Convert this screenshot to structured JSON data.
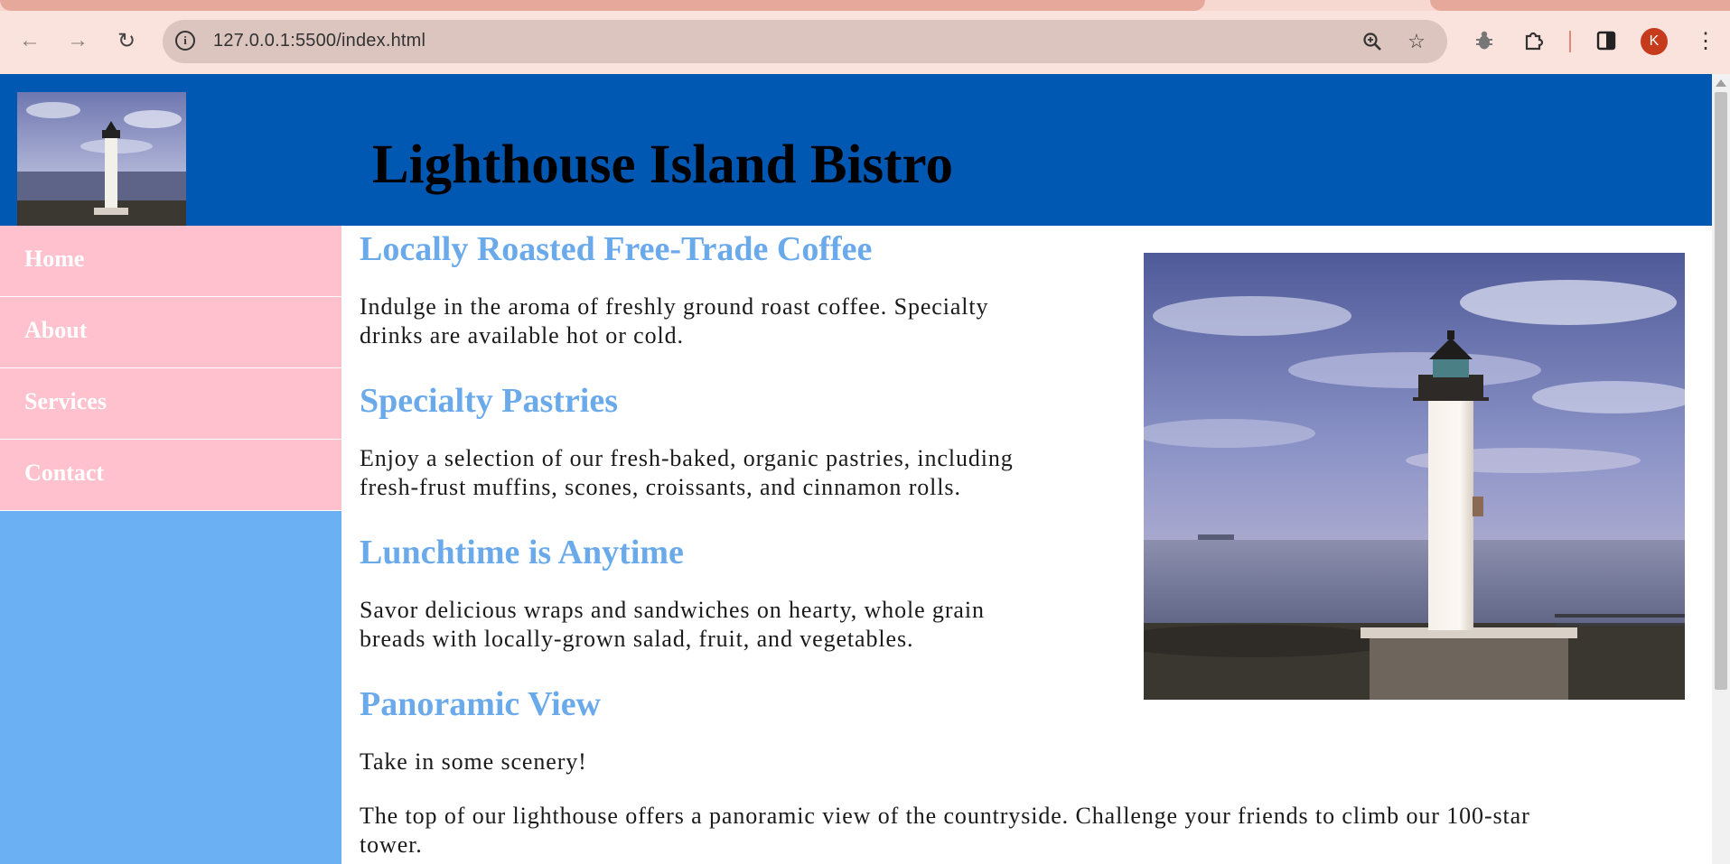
{
  "browser": {
    "url": "127.0.0.1:5500/index.html",
    "profile_initial": "K",
    "icons": {
      "back": "back-arrow-icon",
      "forward": "forward-arrow-icon",
      "reload": "reload-icon",
      "site_info": "info-icon",
      "zoom": "zoom-icon",
      "bookmark": "star-icon",
      "extension_bug": "bug-icon",
      "extensions": "puzzle-icon",
      "side_panel": "side-panel-icon",
      "menu": "more-vert-icon"
    },
    "colors": {
      "frame": "#fbe3dd",
      "omnibox": "#dcc5bf",
      "profile": "#c53b1b"
    }
  },
  "header": {
    "title": "Lighthouse Island Bistro",
    "logo": "lighthouse-logo-image",
    "background": "#0158b3"
  },
  "nav": {
    "items": [
      {
        "label": "Home"
      },
      {
        "label": "About"
      },
      {
        "label": "Services"
      },
      {
        "label": "Contact"
      }
    ],
    "item_color": "#ffc1cd",
    "sidebar_color": "#6bb0f3"
  },
  "main": {
    "hero_image": "lighthouse-photo",
    "heading_color": "#6aaaeb",
    "sections": [
      {
        "heading": "Locally Roasted Free-Trade Coffee",
        "text_line1": "Indulge in the aroma of freshly ground roast coffee. Specialty",
        "text_line2": "drinks are available hot or cold."
      },
      {
        "heading": "Specialty Pastries",
        "text_line1": "Enjoy a selection of our fresh-baked, organic pastries, including",
        "text_line2": "fresh-frust muffins, scones, croissants, and cinnamon rolls."
      },
      {
        "heading": "Lunchtime is Anytime",
        "text_line1": "Savor delicious wraps and sandwiches on hearty, whole grain",
        "text_line2": "breads with locally-grown salad, fruit, and vegetables."
      },
      {
        "heading": "Panoramic View",
        "text1": "Take in some scenery!",
        "text2_line1": "The top of our lighthouse offers a panoramic view of the countryside. Challenge your friends to climb our 100-star",
        "text2_line2": "tower."
      }
    ]
  }
}
